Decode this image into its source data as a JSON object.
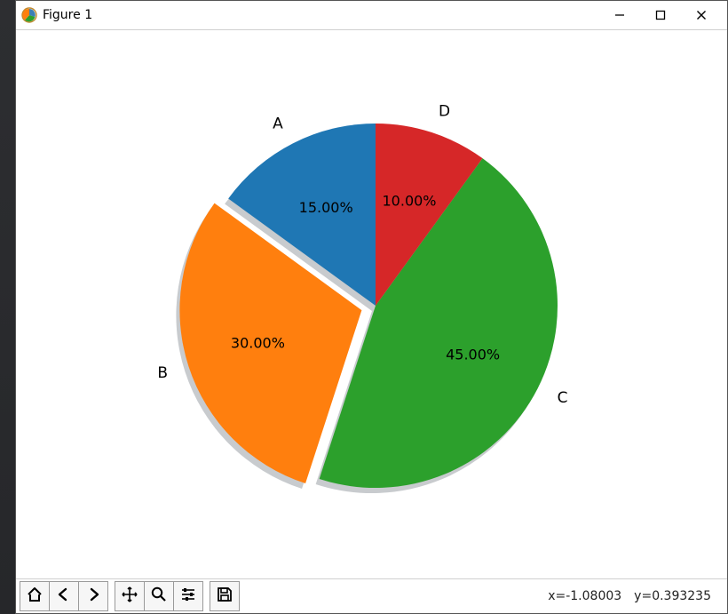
{
  "window": {
    "title": "Figure 1"
  },
  "toolbar": {
    "coord_x_label": "x=-1.08003",
    "coord_y_label": "y=0.393235"
  },
  "chart_data": {
    "type": "pie",
    "title": "",
    "start_angle_deg": 90,
    "counterclockwise": true,
    "shadow": true,
    "slices": [
      {
        "label": "A",
        "value": 15,
        "pct_label": "15.00%",
        "color": "#1f77b4",
        "explode": 0
      },
      {
        "label": "B",
        "value": 30,
        "pct_label": "30.00%",
        "color": "#ff7f0e",
        "explode": 0.08
      },
      {
        "label": "C",
        "value": 45,
        "pct_label": "45.00%",
        "color": "#2ca02c",
        "explode": 0
      },
      {
        "label": "D",
        "value": 10,
        "pct_label": "10.00%",
        "color": "#d62728",
        "explode": 0
      }
    ]
  }
}
